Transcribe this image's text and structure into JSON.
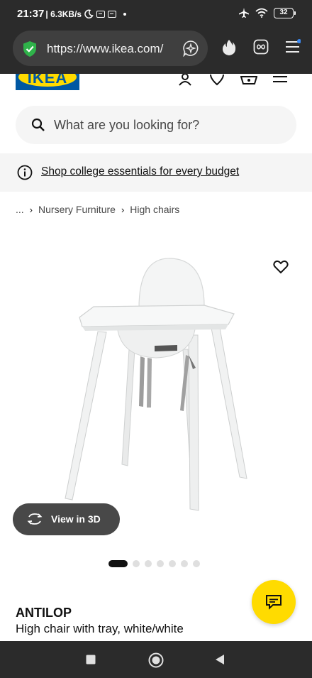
{
  "status_bar": {
    "time": "21:37",
    "speed": "| 6.3KB/s",
    "battery": "32"
  },
  "browser": {
    "url": "https://www.ikea.com/"
  },
  "header": {
    "logo_text": "IKEA",
    "icons": [
      "user-icon",
      "heart-icon",
      "basket-icon",
      "menu-icon"
    ]
  },
  "search": {
    "placeholder": "What are you looking for?"
  },
  "banner": {
    "link_text": "Shop college essentials for every budget"
  },
  "breadcrumb": {
    "items": [
      "...",
      "Nursery Furniture",
      "High chairs"
    ]
  },
  "product": {
    "view_3d_label": "View in 3D",
    "image_count": 7,
    "active_image": 1,
    "name": "ANTILOP",
    "description": "High chair with tray, white/white"
  },
  "colors": {
    "ikea_blue": "#0058a3",
    "ikea_yellow": "#ffdb00",
    "dark_chrome": "#2b2b2b",
    "button_dark": "#484848"
  }
}
